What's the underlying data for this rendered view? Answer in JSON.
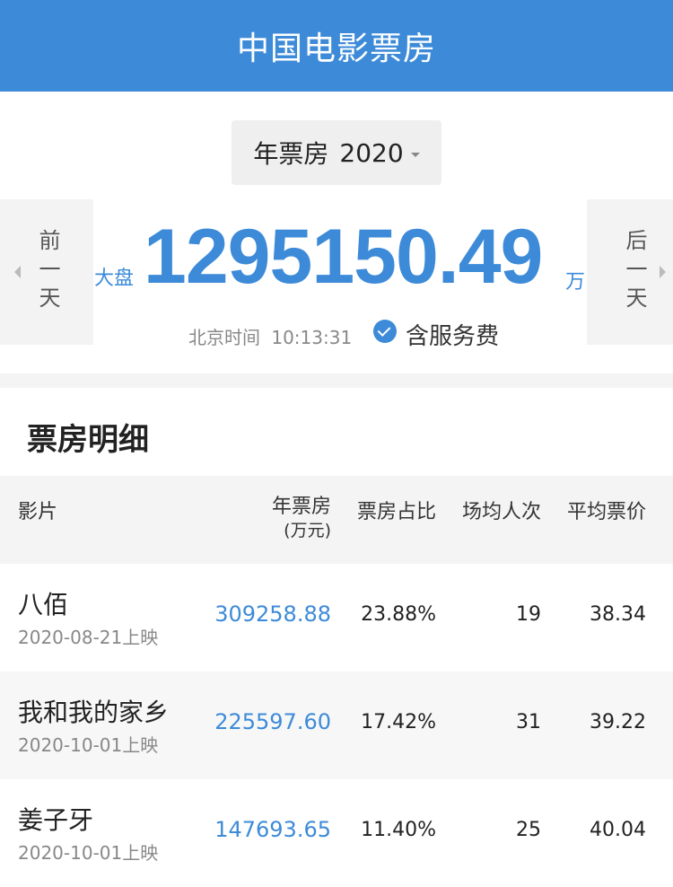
{
  "header": {
    "title": "中国电影票房"
  },
  "selector": {
    "label": "年票房",
    "year": "2020"
  },
  "nav": {
    "prev_label": "前一天",
    "next_label": "后一天"
  },
  "summary": {
    "label": "大盘",
    "value": "1295150.49",
    "unit": "万",
    "time_label": "北京时间",
    "time_value": "10:13:31",
    "service_fee_label": "含服务费"
  },
  "section": {
    "title": "票房明细"
  },
  "table": {
    "headers": {
      "film": "影片",
      "box": "年票房",
      "box_unit": "(万元)",
      "share": "票房占比",
      "attendance": "场均人次",
      "avg_price": "平均票价"
    },
    "rows": [
      {
        "name": "八佰",
        "date": "2020-08-21上映",
        "box": "309258.88",
        "share": "23.88%",
        "attendance": "19",
        "avg_price": "38.34"
      },
      {
        "name": "我和我的家乡",
        "date": "2020-10-01上映",
        "box": "225597.60",
        "share": "17.42%",
        "attendance": "31",
        "avg_price": "39.22"
      },
      {
        "name": "姜子牙",
        "date": "2020-10-01上映",
        "box": "147693.65",
        "share": "11.40%",
        "attendance": "25",
        "avg_price": "40.04"
      }
    ]
  },
  "colors": {
    "accent": "#3d8bd8",
    "header_bg": "#3d8bd8",
    "row_alt": "#f7f7f7"
  }
}
